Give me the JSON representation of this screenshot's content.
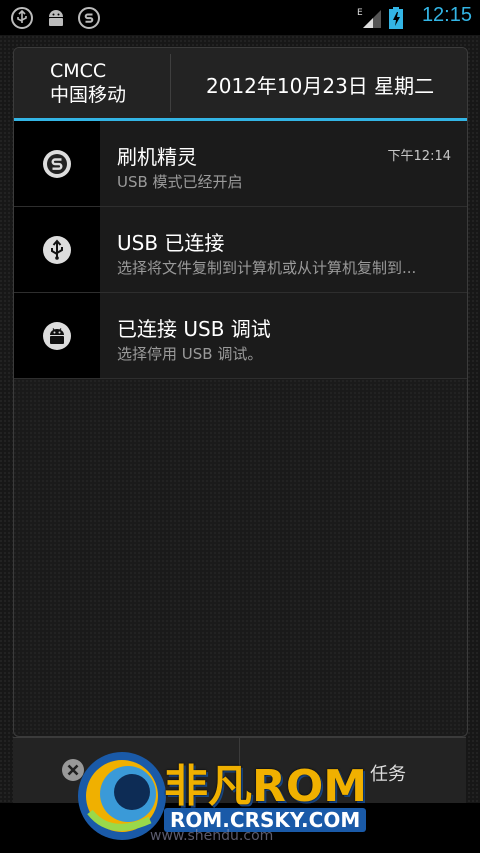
{
  "status_bar": {
    "time": "12:15",
    "left_icons": [
      "usb-icon",
      "android-debug-icon",
      "app-s-icon"
    ],
    "network_type": "E",
    "accent_color": "#33b5e5"
  },
  "panel_header": {
    "carrier_line1": "CMCC",
    "carrier_line2": "中国移动",
    "date": "2012年10月23日 星期二"
  },
  "notifications": [
    {
      "icon": "app-s-icon",
      "title": "刷机精灵",
      "subtitle": "USB 模式已经开启",
      "time": "下午12:14"
    },
    {
      "icon": "usb-icon",
      "title": "USB 已连接",
      "subtitle": "选择将文件复制到计算机或从计算机复制到..."
    },
    {
      "icon": "android-debug-icon",
      "title": "已连接 USB 调试",
      "subtitle": "选择停用 USB 调试。"
    }
  ],
  "bottom_buttons": {
    "left_label": "清除",
    "right_label": "任务"
  },
  "watermark": {
    "main": "非凡ROM",
    "sub": "ROM.CRSKY.COM",
    "url": "www.shendu.com"
  }
}
